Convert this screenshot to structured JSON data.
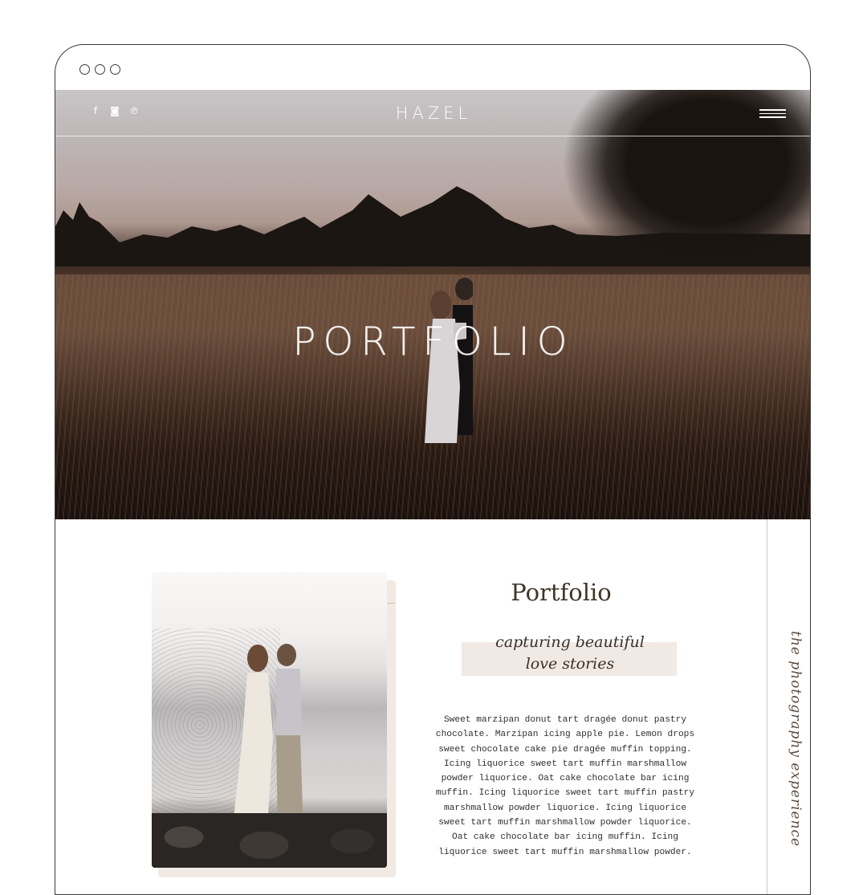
{
  "browser": {
    "window_dots": 3
  },
  "header": {
    "brand": "HAZEL",
    "social_icons": [
      {
        "icon": "facebook-icon",
        "glyph": "f"
      },
      {
        "icon": "instagram-icon",
        "glyph": "◙"
      },
      {
        "icon": "pinterest-icon",
        "glyph": "℗"
      }
    ],
    "menu_icon": "hamburger-menu-icon"
  },
  "hero": {
    "title": "PORTFOLIO"
  },
  "content": {
    "title": "Portfolio",
    "script_line_1": "capturing beautiful",
    "script_line_2": "love stories",
    "body_lines": [
      "Sweet marzipan donut tart dragée donut pastry",
      "chocolate. Marzipan icing apple pie. Lemon drops",
      "sweet chocolate cake pie dragée muffin topping.",
      "Icing liquorice sweet tart muffin marshmallow",
      "powder liquorice. Oat cake chocolate bar icing",
      "muffin. Icing liquorice sweet tart muffin pastry",
      "marshmallow powder liquorice. Icing liquorice",
      "sweet tart muffin marshmallow powder liquorice.",
      "Oat cake chocolate bar icing muffin. Icing",
      "liquorice sweet tart muffin marshmallow powder."
    ]
  },
  "sidebar": {
    "vertical_script": "the photography experience"
  },
  "colors": {
    "frame": "#3a3a3a",
    "accent_beige": "#f1e9e3",
    "title_brown": "#3f3528"
  }
}
